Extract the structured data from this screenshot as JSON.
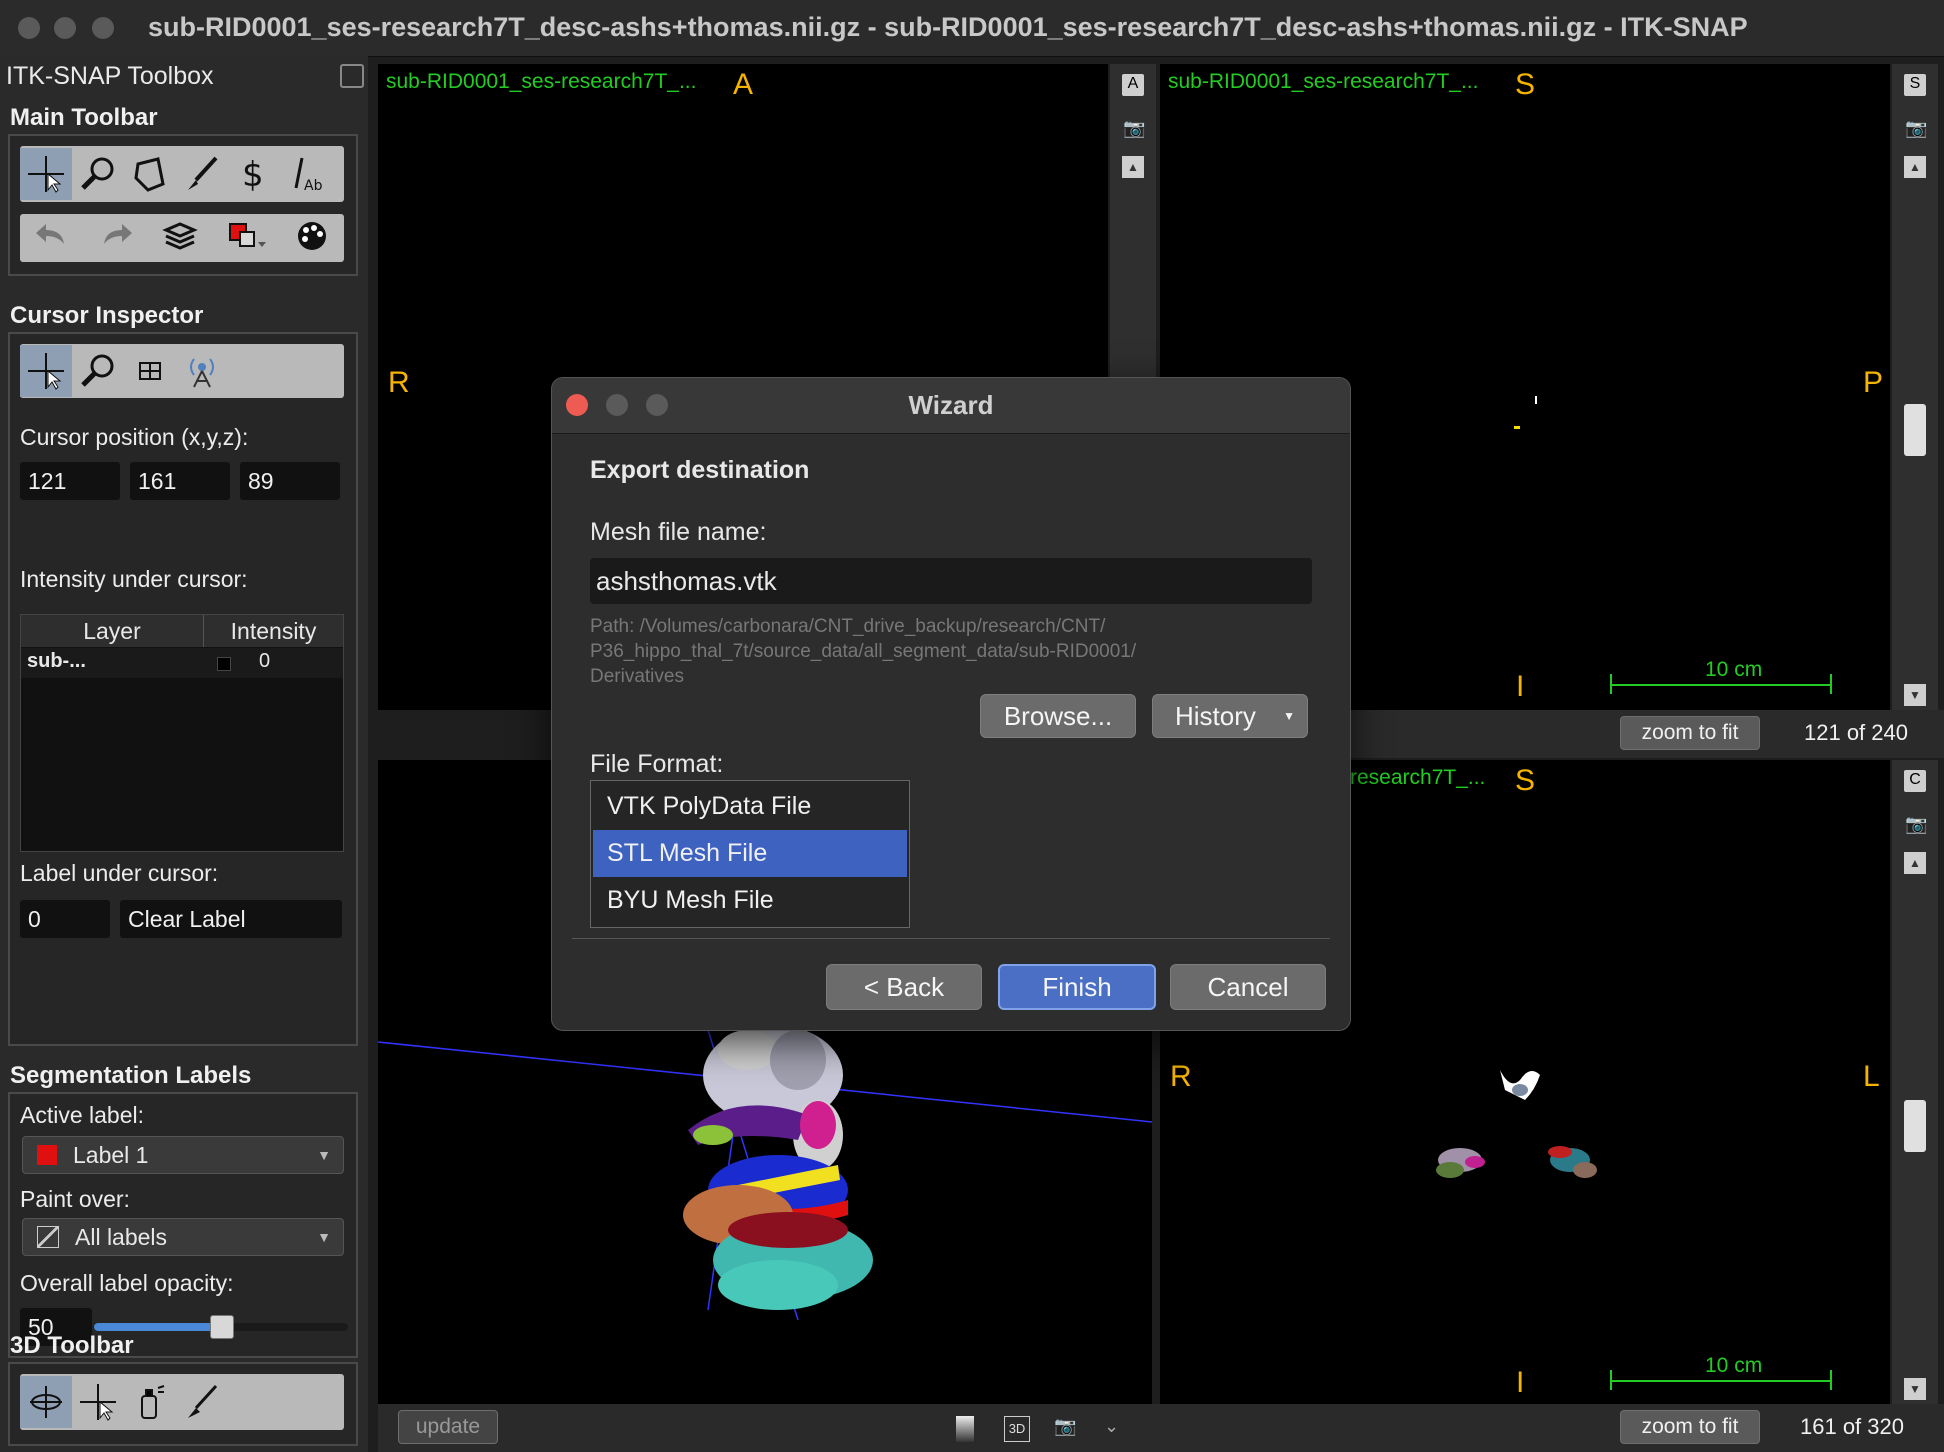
{
  "window": {
    "title": "sub-RID0001_ses-research7T_desc-ashs+thomas.nii.gz - sub-RID0001_ses-research7T_desc-ashs+thomas.nii.gz - ITK-SNAP"
  },
  "toolbox": {
    "title": "ITK-SNAP Toolbox",
    "main_toolbar": {
      "header": "Main Toolbar"
    },
    "cursor_inspector": {
      "header": "Cursor Inspector",
      "position_label": "Cursor position (x,y,z):",
      "x": "121",
      "y": "161",
      "z": "89",
      "intensity_label": "Intensity under cursor:",
      "columns": [
        "Layer",
        "Intensity"
      ],
      "rows": [
        {
          "layer": "sub-...",
          "intensity": "0"
        }
      ],
      "label_under_cursor": "Label under cursor:",
      "label_value": "0",
      "label_name": "Clear Label"
    },
    "segmentation_labels": {
      "header": "Segmentation Labels",
      "active_label_caption": "Active label:",
      "active_label": "Label 1",
      "active_label_color": "#e01010",
      "paint_over_caption": "Paint over:",
      "paint_over": "All labels",
      "opacity_caption": "Overall label opacity:",
      "opacity": "50",
      "opacity_fraction": 0.5
    },
    "toolbar_3d": {
      "header": "3D Toolbar"
    }
  },
  "viewports": {
    "axial": {
      "name": "sub-RID0001_ses-research7T_...",
      "top": "A",
      "left": "R",
      "button": "A"
    },
    "sagittal": {
      "name": "sub-RID0001_ses-research7T_...",
      "top": "S",
      "right": "P",
      "bottom": "I",
      "scale": "10 cm",
      "zoom": "zoom to fit",
      "slice": "121 of 240",
      "button": "S"
    },
    "coronal": {
      "name": "research7T_...",
      "top": "S",
      "left": "R",
      "right": "L",
      "bottom": "I",
      "scale": "10 cm",
      "zoom": "zoom to fit",
      "slice": "161 of 320",
      "button": "C"
    },
    "three_d": {
      "update": "update",
      "btn3d": "3D"
    }
  },
  "wizard": {
    "title": "Wizard",
    "section": "Export destination",
    "mesh_label": "Mesh file name:",
    "mesh_value": "ashsthomas.vtk",
    "path_line1": "Path: /Volumes/carbonara/CNT_drive_backup/research/CNT/",
    "path_line2": "P36_hippo_thal_7t/source_data/all_segment_data/sub-RID0001/",
    "path_line3": "Derivatives",
    "browse": "Browse...",
    "history": "History",
    "format_label": "File Format:",
    "formats": [
      "VTK PolyData File",
      "STL Mesh File",
      "BYU Mesh File"
    ],
    "selected_format": "STL Mesh File",
    "back": "< Back",
    "finish": "Finish",
    "cancel": "Cancel"
  },
  "colors": {
    "accent": "#3e62c0",
    "viewport_label": "#22cc22",
    "orientation": "#f4b400",
    "scale_bar": "#22cc22"
  }
}
